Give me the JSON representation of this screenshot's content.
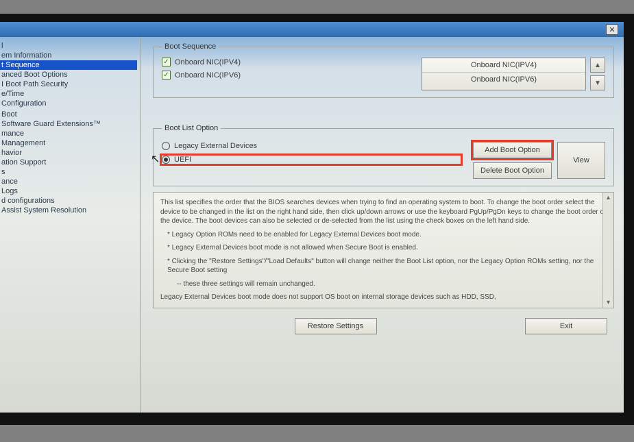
{
  "window": {
    "close_glyph": "✕"
  },
  "sidebar": {
    "items": [
      "l",
      "em Information",
      "t Sequence",
      "anced Boot Options",
      "I Boot Path Security",
      "e/Time",
      "Configuration",
      "",
      "Boot",
      "Software Guard Extensions™",
      "mance",
      "Management",
      "havior",
      "ation Support",
      "s",
      "ance",
      "Logs",
      "d configurations",
      "Assist System Resolution"
    ],
    "selected_index": 2
  },
  "boot_sequence": {
    "legend": "Boot Sequence",
    "checks": [
      {
        "label": "Onboard NIC(IPV4)",
        "checked": true
      },
      {
        "label": "Onboard NIC(IPV6)",
        "checked": true
      }
    ],
    "list": [
      "Onboard NIC(IPV4)",
      "Onboard NIC(IPV6)"
    ],
    "up_glyph": "▲",
    "down_glyph": "▼"
  },
  "boot_list_option": {
    "legend": "Boot List Option",
    "radios": [
      {
        "label": "Legacy External Devices",
        "checked": false
      },
      {
        "label": "UEFI",
        "checked": true
      }
    ],
    "buttons": {
      "add": "Add Boot Option",
      "delete": "Delete Boot Option",
      "view": "View"
    }
  },
  "help": {
    "p1": "This list specifies the order that the BIOS searches devices when trying to find an operating system to boot. To change the boot order select the device to be changed in the list on the right hand side, then click up/down arrows or use the keyboard PgUp/PgDn keys to change the boot order of the device. The boot devices can also be selected or de-selected from the list using the check boxes on the left hand side.",
    "b1": "* Legacy Option ROMs need to be enabled for Legacy External Devices boot mode.",
    "b2": "* Legacy External Devices boot mode is not allowed when Secure Boot is enabled.",
    "b3": "* Clicking the \"Restore Settings\"/\"Load Defaults\" button will change neither the Boot List option, nor the Legacy Option ROMs setting, nor the Secure Boot setting",
    "b3b": "-- these three settings will remain unchanged.",
    "p2": "Legacy External Devices boot mode does not support OS boot on internal storage devices such as HDD, SSD,",
    "scroll_up": "▴",
    "scroll_down": "▾"
  },
  "footer": {
    "restore": "Restore Settings",
    "exit": "Exit"
  },
  "cursor_glyph": "↖"
}
